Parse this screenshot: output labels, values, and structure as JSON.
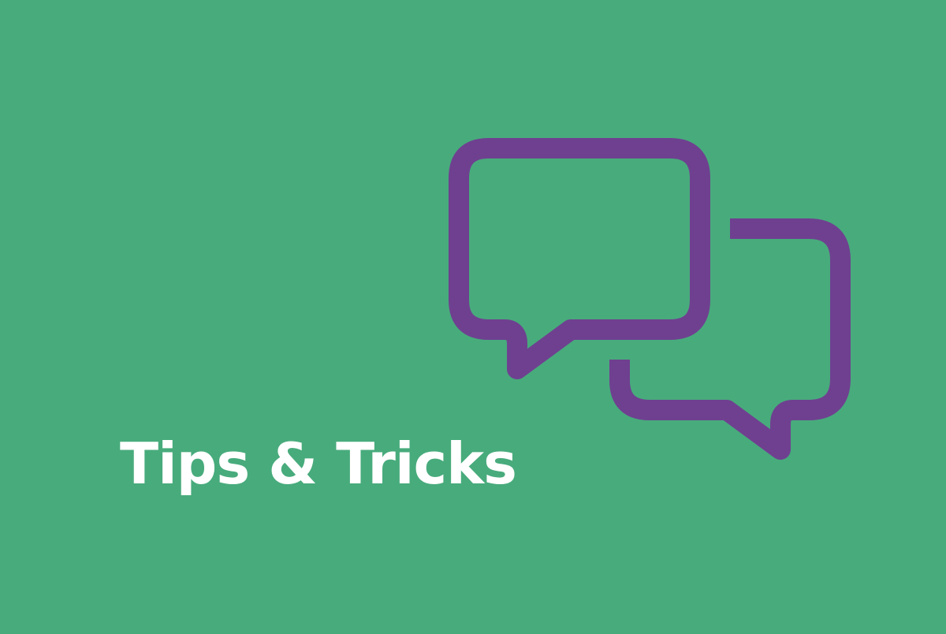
{
  "banner": {
    "title": "Tips & Tricks",
    "background_color": "#48ab7c",
    "title_color": "#ffffff",
    "icon": "chat-bubbles-icon",
    "icon_color": "#6f4090"
  }
}
